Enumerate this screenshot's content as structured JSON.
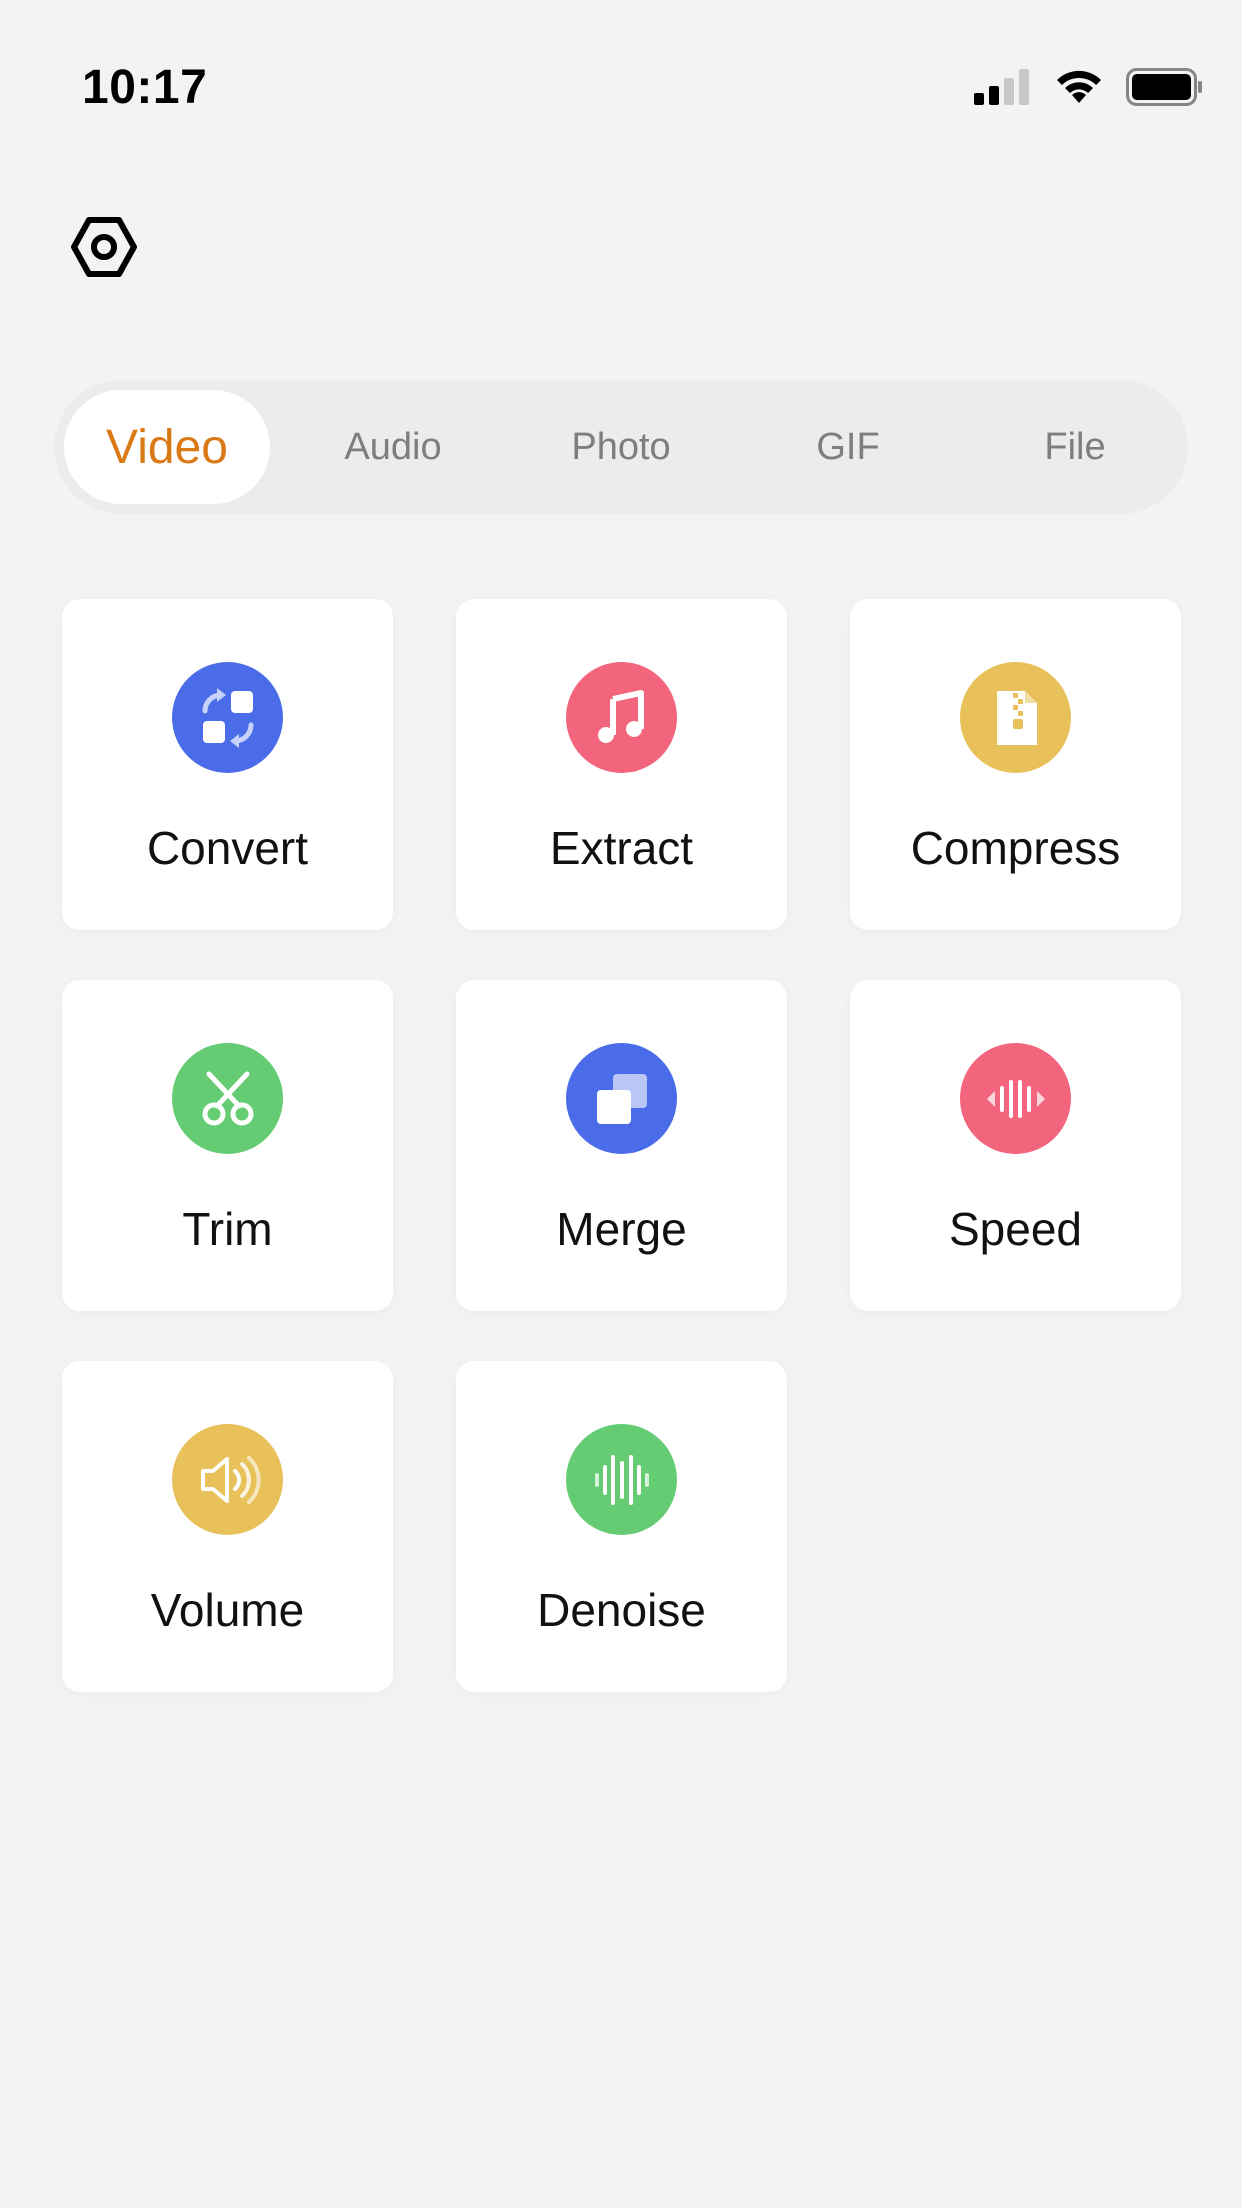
{
  "status_bar": {
    "time": "10:17"
  },
  "tabs": [
    {
      "label": "Video",
      "active": true
    },
    {
      "label": "Audio",
      "active": false
    },
    {
      "label": "Photo",
      "active": false
    },
    {
      "label": "GIF",
      "active": false
    },
    {
      "label": "File",
      "active": false
    }
  ],
  "tools": [
    {
      "label": "Convert",
      "icon": "convert-icon",
      "color": "#4a6ce8"
    },
    {
      "label": "Extract",
      "icon": "music-note-icon",
      "color": "#f2657c"
    },
    {
      "label": "Compress",
      "icon": "zip-file-icon",
      "color": "#e8c15b"
    },
    {
      "label": "Trim",
      "icon": "scissors-icon",
      "color": "#66cc74"
    },
    {
      "label": "Merge",
      "icon": "merge-icon",
      "color": "#4a6ce8"
    },
    {
      "label": "Speed",
      "icon": "speed-icon",
      "color": "#f2657c"
    },
    {
      "label": "Volume",
      "icon": "speaker-icon",
      "color": "#e8c15b"
    },
    {
      "label": "Denoise",
      "icon": "sound-wave-icon",
      "color": "#66cc74"
    }
  ],
  "colors": {
    "accent": "#d97a16",
    "background": "#f3f3f4"
  }
}
